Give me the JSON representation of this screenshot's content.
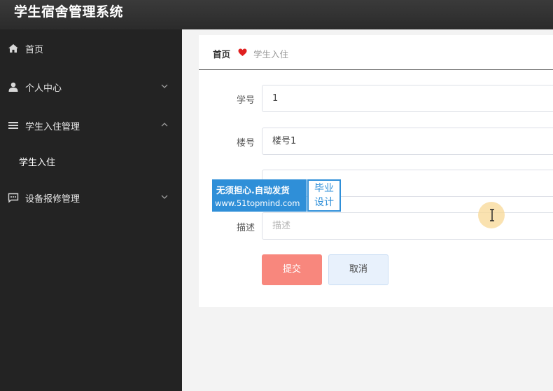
{
  "app": {
    "title": "学生宿舍管理系统"
  },
  "sidebar": {
    "items": [
      {
        "label": "首页",
        "icon": "home-icon"
      },
      {
        "label": "个人中心",
        "icon": "user-icon",
        "chevron": "chevron-down-icon"
      },
      {
        "label": "学生入住管理",
        "icon": "list-icon",
        "chevron": "chevron-up-icon"
      },
      {
        "label": "设备报修管理",
        "icon": "chat-icon",
        "chevron": "chevron-down-icon"
      }
    ],
    "subitems": [
      {
        "label": "学生入住"
      }
    ]
  },
  "breadcrumb": {
    "home": "首页",
    "current": "学生入住",
    "separator_icon": "heart-icon"
  },
  "form": {
    "student_id": {
      "label": "学号",
      "value": "1"
    },
    "building": {
      "label": "楼号",
      "value": "楼号1"
    },
    "description": {
      "label": "描述",
      "placeholder": "描述"
    }
  },
  "buttons": {
    "submit": "提交",
    "cancel": "取消"
  },
  "watermark": {
    "line1": "无须担心.自动发货",
    "line2": "www.51topmind.com",
    "badge_line1": "毕业",
    "badge_line2": "设计"
  },
  "colors": {
    "submit": "#f8877d",
    "sidebar": "#232323",
    "heart": "#e02020",
    "watermark": "#2f8fd8"
  }
}
